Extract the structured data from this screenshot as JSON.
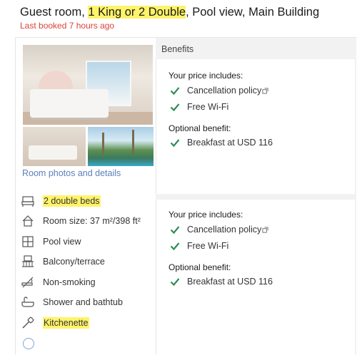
{
  "room": {
    "title_parts": {
      "prefix": "Guest room, ",
      "highlight": "1 King or 2 Double",
      "suffix": ", Pool view, Main Building"
    },
    "last_booked": "Last booked 7 hours ago",
    "photos_link": "Room photos and details"
  },
  "amenities": [
    {
      "icon": "bed-icon",
      "label": "2 double beds",
      "highlighted": true
    },
    {
      "icon": "house-icon",
      "label": "Room size: 37 m²/398 ft²",
      "highlighted": false
    },
    {
      "icon": "window-icon",
      "label": "Pool view",
      "highlighted": false
    },
    {
      "icon": "balcony-icon",
      "label": "Balcony/terrace",
      "highlighted": false
    },
    {
      "icon": "no-smoking-icon",
      "label": "Non-smoking",
      "highlighted": false
    },
    {
      "icon": "bathtub-icon",
      "label": "Shower and bathtub",
      "highlighted": false
    },
    {
      "icon": "kitchenette-icon",
      "label": "Kitchenette",
      "highlighted": true
    }
  ],
  "benefits": {
    "header": "Benefits",
    "options": [
      {
        "price_includes_heading": "Your price includes:",
        "includes": [
          "Cancellation policy",
          "Free Wi-Fi"
        ],
        "optional_heading": "Optional benefit:",
        "optional": [
          "Breakfast at USD 116"
        ]
      },
      {
        "price_includes_heading": "Your price includes:",
        "includes": [
          "Cancellation policy",
          "Free Wi-Fi"
        ],
        "optional_heading": "Optional benefit:",
        "optional": [
          "Breakfast at USD 116"
        ]
      }
    ]
  },
  "colors": {
    "highlight": "#fff36a",
    "alert": "#d9433a",
    "link": "#5c7ebd",
    "check": "#2e8b57"
  }
}
